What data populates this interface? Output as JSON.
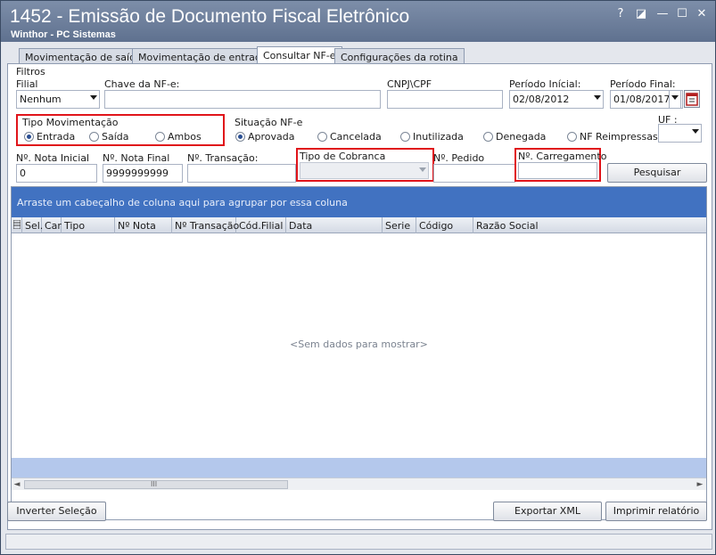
{
  "window": {
    "title": "1452 - Emissão de Documento Fiscal Eletrônico",
    "subtitle": "Winthor - PC Sistemas",
    "controls": [
      "?",
      "◪",
      "—",
      "☐",
      "✕"
    ]
  },
  "tabs": [
    {
      "label": "Movimentação de saída"
    },
    {
      "label": "Movimentação de entrada"
    },
    {
      "label": "Consultar NF-e",
      "active": true
    },
    {
      "label": "Configurações da rotina"
    }
  ],
  "filters": {
    "group_label": "Filtros",
    "filial": {
      "label": "Filial",
      "value": "Nenhum"
    },
    "chave": {
      "label": "Chave da NF-e:",
      "value": ""
    },
    "cnpj": {
      "label": "CNPJ\\CPF",
      "value": ""
    },
    "periodo_inicial": {
      "label": "Período Inícial:",
      "value": "02/08/2012"
    },
    "periodo_final": {
      "label": "Período Final:",
      "value": "01/08/2017"
    },
    "tipo_movimentacao": {
      "label": "Tipo Movimentação",
      "options": [
        "Entrada",
        "Saída",
        "Ambos"
      ],
      "selected": "Entrada"
    },
    "situacao": {
      "label": "Situação NF-e",
      "options": [
        "Aprovada",
        "Cancelada",
        "Inutilizada",
        "Denegada",
        "NF Reimpressas"
      ],
      "selected": "Aprovada"
    },
    "uf": {
      "label": "UF :",
      "value": ""
    },
    "nota_inicial": {
      "label": "Nº. Nota Inicial",
      "value": "0"
    },
    "nota_final": {
      "label": "Nº. Nota Final",
      "value": "9999999999"
    },
    "transacao": {
      "label": "Nº. Transação:",
      "value": ""
    },
    "tipo_cobranca": {
      "label": "Tipo de Cobranca",
      "value": ""
    },
    "pedido": {
      "label": "Nº. Pedido",
      "value": ""
    },
    "carregamento": {
      "label": "Nº. Carregamento",
      "value": ""
    },
    "search_button": "Pesquisar"
  },
  "grid": {
    "group_hint": "Arraste um cabeçalho de coluna aqui para agrupar por essa coluna",
    "columns": [
      "Sel.",
      "Car",
      "Tipo",
      "Nº Nota",
      "Nº Transação",
      "Cód.Filial",
      "Data",
      "Serie",
      "Código",
      "Razão Social"
    ],
    "empty_message": "<Sem dados para mostrar>",
    "scroll_grip": "III"
  },
  "buttons": {
    "invert": "Inverter Seleção",
    "export": "Exportar XML",
    "print": "Imprimir relatório"
  },
  "colors": {
    "titlebar": "#6d7f9c",
    "group_panel": "#4172c1",
    "highlight": "#e0141a"
  }
}
